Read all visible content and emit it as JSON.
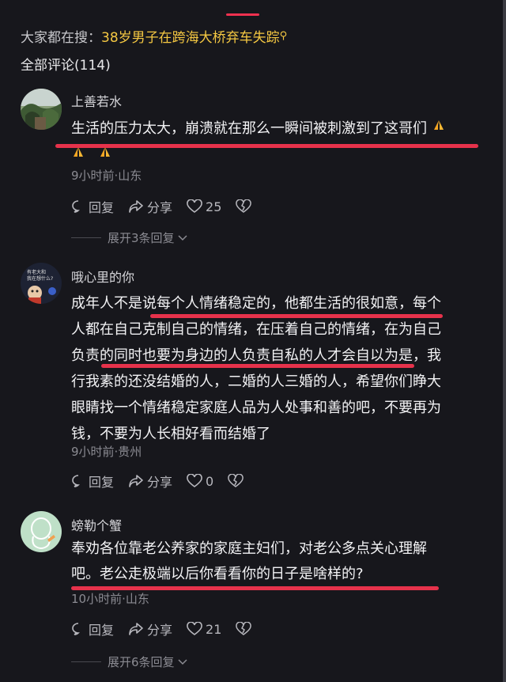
{
  "search": {
    "prefix": "大家都在搜：",
    "term": "38岁男子在跨海大桥弃车失踪",
    "icon": "search-icon"
  },
  "comments_header": {
    "title": "全部评论(114)"
  },
  "comments": [
    {
      "username": "上善若水",
      "text_line1": "生活的压力太大，崩溃就在那么一瞬间被刺激到了这哥们",
      "meta": "9小时前·山东",
      "reply_label": "回复",
      "share_label": "分享",
      "like_count": "25",
      "expand_label": "展开3条回复"
    },
    {
      "username": "哦心里的你",
      "lines": [
        "成年人不是说每个人情绪稳定的，他都生活的很如意，每个",
        "人都在自己克制自己的情绪，在压着自己的情绪，在为自己",
        "负责的同时也要为身边的人负责自私的人才会自以为是，我",
        "行我素的还没结婚的人，二婚的人三婚的人，希望你们睁大",
        "眼睛找一个情绪稳定家庭人品为人处事和善的吧，不要再为",
        "钱，不要为人长相好看而结婚了"
      ],
      "meta": "9小时前·贵州",
      "reply_label": "回复",
      "share_label": "分享",
      "like_count": "0"
    },
    {
      "username": "螃勒个蟹",
      "lines": [
        "奉劝各位靠老公养家的家庭主妇们，对老公多点关心理解",
        "吧。老公走极端以后你看看你的日子是啥样的?"
      ],
      "meta": "10小时前·山东",
      "reply_label": "回复",
      "share_label": "分享",
      "like_count": "21",
      "expand_label": "展开6条回复"
    }
  ],
  "colors": {
    "background": "#17171c",
    "accent": "#f5c842",
    "highlight": "#e6324b"
  }
}
